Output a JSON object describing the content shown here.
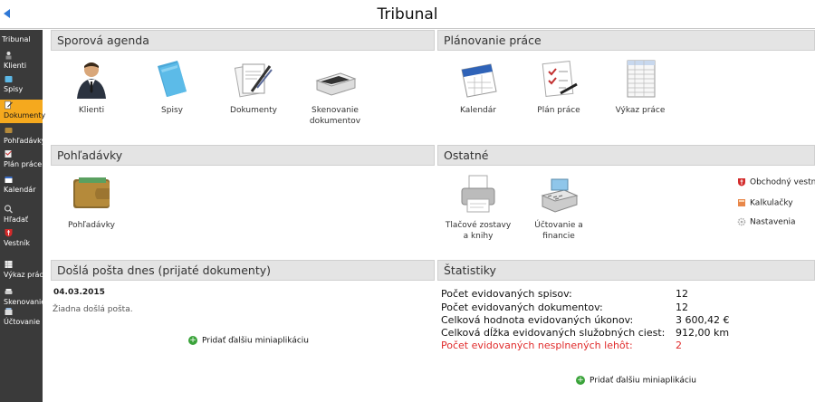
{
  "app": {
    "title": "Tribunal"
  },
  "sidebar": {
    "header": "Tribunal",
    "items": [
      {
        "label": "Klienti",
        "icon": "client-icon"
      },
      {
        "label": "Spisy",
        "icon": "folder-icon"
      },
      {
        "label": "Dokumenty",
        "icon": "documents-icon",
        "active": true
      },
      {
        "label": "Pohľadávky",
        "icon": "wallet-icon"
      },
      {
        "label": "Plán práce",
        "icon": "plan-icon"
      },
      {
        "label": "Kalendár",
        "icon": "calendar-icon"
      },
      {
        "label": "Hľadať",
        "icon": "search-icon"
      },
      {
        "label": "Vestník",
        "icon": "gazette-icon"
      },
      {
        "label": "Výkaz práce",
        "icon": "worksheet-icon"
      },
      {
        "label": "Skenovanie",
        "icon": "scanner-icon"
      },
      {
        "label": "Účtovanie",
        "icon": "accounting-icon"
      }
    ]
  },
  "panels": {
    "sporova": {
      "title": "Sporová agenda",
      "tiles": [
        {
          "label": "Klienti"
        },
        {
          "label": "Spisy"
        },
        {
          "label": "Dokumenty"
        },
        {
          "label": "Skenovanie dokumentov"
        }
      ]
    },
    "planovanie": {
      "title": "Plánovanie práce",
      "tiles": [
        {
          "label": "Kalendár"
        },
        {
          "label": "Plán práce"
        },
        {
          "label": "Výkaz práce"
        }
      ]
    },
    "pohladavky": {
      "title": "Pohľadávky",
      "tiles": [
        {
          "label": "Pohľadávky"
        }
      ]
    },
    "ostatne": {
      "title": "Ostatné",
      "tiles": [
        {
          "label": "Tlačové zostavy a knihy"
        },
        {
          "label": "Účtovanie a financie"
        }
      ],
      "links": [
        {
          "label": "Obchodný vestník"
        },
        {
          "label": "Kalkulačky"
        },
        {
          "label": "Nastavenia"
        }
      ]
    },
    "posta": {
      "title": "Došlá pošta dnes (prijaté dokumenty)",
      "date": "04.03.2015",
      "empty_text": "Žiadna došlá pošta.",
      "add_label": "Pridať ďalšiu miniaplikáciu"
    },
    "statistiky": {
      "title": "Štatistiky",
      "rows": [
        {
          "label": "Počet evidovaných spisov:",
          "value": "12"
        },
        {
          "label": "Počet evidovaných dokumentov:",
          "value": "12"
        },
        {
          "label": "Celková hodnota evidovaných úkonov:",
          "value": "3 600,42 €"
        },
        {
          "label": "Celková dĺžka evidovaných služobných ciest:",
          "value": "912,00 km"
        },
        {
          "label": "Počet evidovaných nesplnených lehôt:",
          "value": "2",
          "highlight": true
        }
      ],
      "add_label": "Pridať ďalšiu miniaplikáciu"
    }
  },
  "colors": {
    "sidebar_bg": "#3a3a3a",
    "active": "#f5a91e",
    "back_arrow": "#2f78d6",
    "alert": "#e02b2b",
    "panel_header": "#e4e4e4",
    "add_icon": "#3aa33a"
  }
}
